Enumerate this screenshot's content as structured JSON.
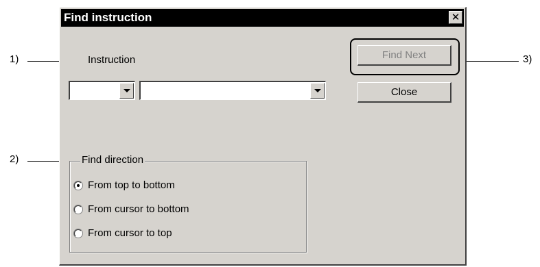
{
  "dialog": {
    "title": "Find instruction",
    "close_glyph": "✕",
    "instruction_label": "Instruction",
    "combo_small_value": "",
    "combo_large_value": "",
    "find_next_label": "Find Next",
    "close_label": "Close",
    "find_direction_label": "Find direction",
    "radios": [
      {
        "label": "From top to bottom",
        "checked": true
      },
      {
        "label": "From cursor to bottom",
        "checked": false
      },
      {
        "label": "From cursor to top",
        "checked": false
      }
    ]
  },
  "callouts": {
    "c1": "1)",
    "c2": "2)",
    "c3": "3)"
  }
}
